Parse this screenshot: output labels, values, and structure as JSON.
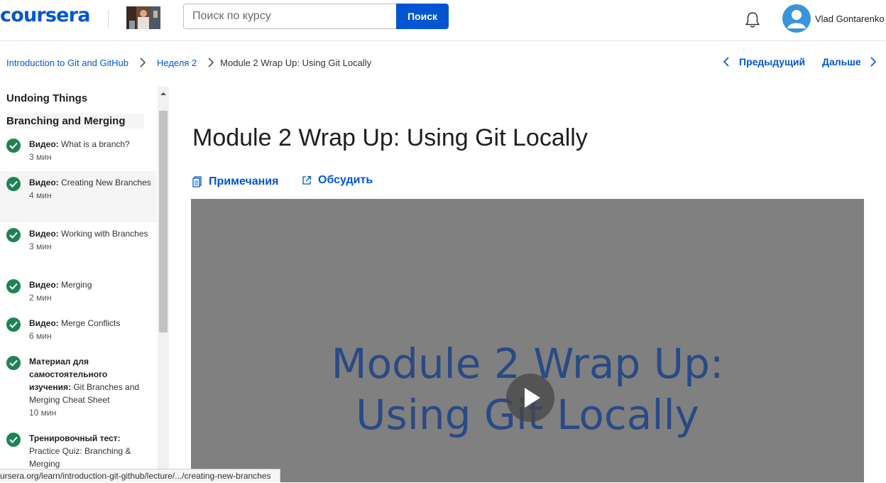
{
  "header": {
    "logo": "coursera",
    "search": {
      "placeholder": "Поиск по курсу",
      "value": ""
    },
    "search_button": "Поиск",
    "user_name": "Vlad Gontarenko"
  },
  "breadcrumb": {
    "course": "Introduction to Git and GitHub",
    "week": "Неделя 2",
    "current": "Module 2 Wrap Up: Using Git Locally"
  },
  "nav": {
    "prev": "Предыдущий",
    "next": "Дальше"
  },
  "sidebar": {
    "sections": [
      "Undoing Things",
      "Branching and Merging"
    ],
    "items": [
      {
        "type": "Видео:",
        "title": "What is a branch?",
        "duration": "3 мин"
      },
      {
        "type": "Видео:",
        "title": "Creating New Branches",
        "duration": "4 мин"
      },
      {
        "type": "Видео:",
        "title": "Working with Branches",
        "duration": "3 мин"
      },
      {
        "type": "Видео:",
        "title": "Merging",
        "duration": "2 мин"
      },
      {
        "type": "Видео:",
        "title": "Merge Conflicts",
        "duration": "6 мин"
      },
      {
        "type": "Материал для самостоятельного изучения:",
        "title": "Git Branches and Merging Cheat Sheet",
        "duration": "10 мин"
      },
      {
        "type": "Тренировочный тест:",
        "title": "Practice Quiz: Branching & Merging",
        "duration": ""
      }
    ]
  },
  "main": {
    "title": "Module 2 Wrap Up: Using Git Locally",
    "notes_label": "Примечания",
    "discuss_label": "Обсудить",
    "video_title_line1": "Module 2 Wrap Up:",
    "video_title_line2": "Using Git Locally"
  },
  "status_bar": "ursera.org/learn/introduction-git-github/lecture/.../creating-new-branches",
  "colors": {
    "brand": "#0056d2",
    "complete": "#1f8354",
    "video_bg": "#808080"
  },
  "icons": [
    "bell-icon",
    "avatar-icon",
    "chevron-right-icon",
    "chevron-left-icon",
    "notes-icon",
    "external-link-icon",
    "check-circle-icon",
    "play-icon"
  ]
}
